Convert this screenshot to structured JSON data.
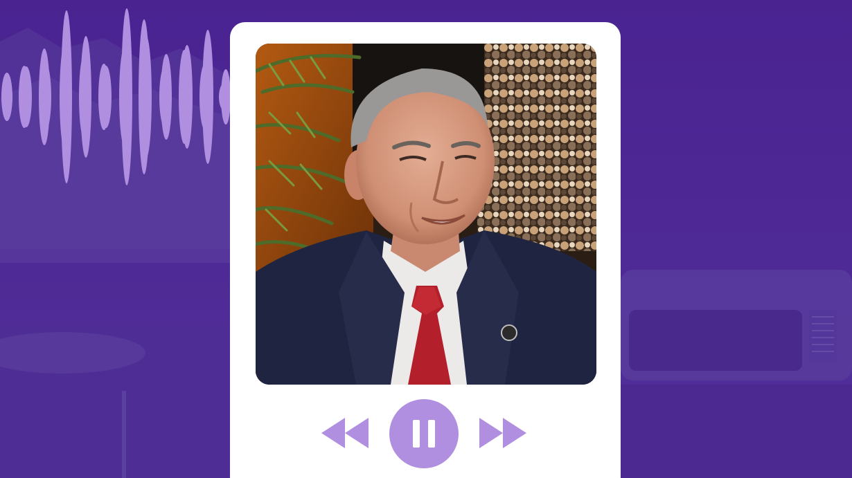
{
  "player": {
    "colors": {
      "background": "#4b2590",
      "accent": "#b08fe0",
      "card": "#ffffff"
    },
    "controls": [
      {
        "name": "rewind",
        "icon": "rewind-icon"
      },
      {
        "name": "pause",
        "icon": "pause-icon"
      },
      {
        "name": "fast-forward",
        "icon": "fast-forward-icon"
      }
    ],
    "cover": {
      "type": "portrait-photo"
    }
  }
}
